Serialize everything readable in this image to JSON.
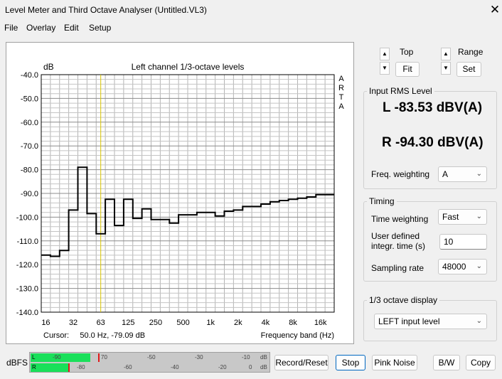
{
  "window": {
    "title": "Level Meter and Third Octave Analyser (Untitled.VL3)",
    "close_glyph": "✕"
  },
  "menu": [
    "File",
    "Overlay",
    "Edit",
    "Setup"
  ],
  "chart_data": {
    "type": "line",
    "title": "Left channel 1/3-octave levels",
    "ylabel": "dB",
    "xlabel": "Frequency band (Hz)",
    "side_label": "ARTA",
    "ylim": [
      -140,
      -40
    ],
    "yticks": [
      "-40.0",
      "-50.0",
      "-60.0",
      "-70.0",
      "-80.0",
      "-90.0",
      "-100.0",
      "-110.0",
      "-120.0",
      "-130.0",
      "-140.0"
    ],
    "xticks": [
      "16",
      "32",
      "63",
      "125",
      "250",
      "500",
      "1k",
      "2k",
      "4k",
      "8k",
      "16k"
    ],
    "cursor_text": "Cursor:     50.0 Hz, -79.09 dB",
    "cursor_band_index": 6,
    "grid": true,
    "bands": [
      "16",
      "20",
      "25",
      "31.5",
      "40",
      "50",
      "63",
      "80",
      "100",
      "125",
      "160",
      "200",
      "250",
      "315",
      "400",
      "500",
      "630",
      "800",
      "1k",
      "1.25k",
      "1.6k",
      "2k",
      "2.5k",
      "3.15k",
      "4k",
      "5k",
      "6.3k",
      "8k",
      "10k",
      "12.5k",
      "16k",
      "20k"
    ],
    "series": [
      {
        "values": [
          -116,
          -116.5,
          -114,
          -97,
          -79,
          -98.5,
          -107,
          -92.5,
          -103.5,
          -92.5,
          -100.5,
          -96.5,
          -101,
          -101,
          -102.5,
          -99,
          -99,
          -98,
          -98,
          -99.5,
          -97.5,
          -97,
          -95.5,
          -95.5,
          -94.5,
          -93.5,
          -93,
          -92.5,
          -92,
          -91.5,
          -90.5,
          -90.5
        ]
      }
    ]
  },
  "controls": {
    "top_label": "Top",
    "fit_label": "Fit",
    "range_label": "Range",
    "set_label": "Set",
    "up_glyph": "▲",
    "down_glyph": "▼"
  },
  "rms": {
    "group_title": "Input RMS Level",
    "left_value": "L -83.53 dBV(A)",
    "right_value": "R -94.30 dBV(A)",
    "freq_weighting_label": "Freq. weighting",
    "freq_weighting_value": "A"
  },
  "timing": {
    "group_title": "Timing",
    "time_weighting_label": "Time weighting",
    "time_weighting_value": "Fast",
    "user_time_label_1": "User defined",
    "user_time_label_2": "integr. time (s)",
    "user_time_value": "10",
    "sampling_rate_label": "Sampling rate",
    "sampling_rate_value": "48000"
  },
  "octave_display": {
    "group_title": "1/3 octave display",
    "value": "LEFT input level"
  },
  "meter": {
    "label": "dBFS",
    "left_channel": "L",
    "right_channel": "R",
    "left_level_fraction": 0.25,
    "right_level_fraction": 0.16,
    "top_scale": [
      "-90",
      "70",
      "-50",
      "-30",
      "-10",
      "dB"
    ],
    "bottom_scale": [
      "-80",
      "-60",
      "-40",
      "-20",
      "0",
      "dB"
    ]
  },
  "buttons": {
    "record_reset": "Record/Reset",
    "stop": "Stop",
    "pink_noise": "Pink Noise",
    "bw": "B/W",
    "copy": "Copy"
  },
  "chevron": "⌄"
}
